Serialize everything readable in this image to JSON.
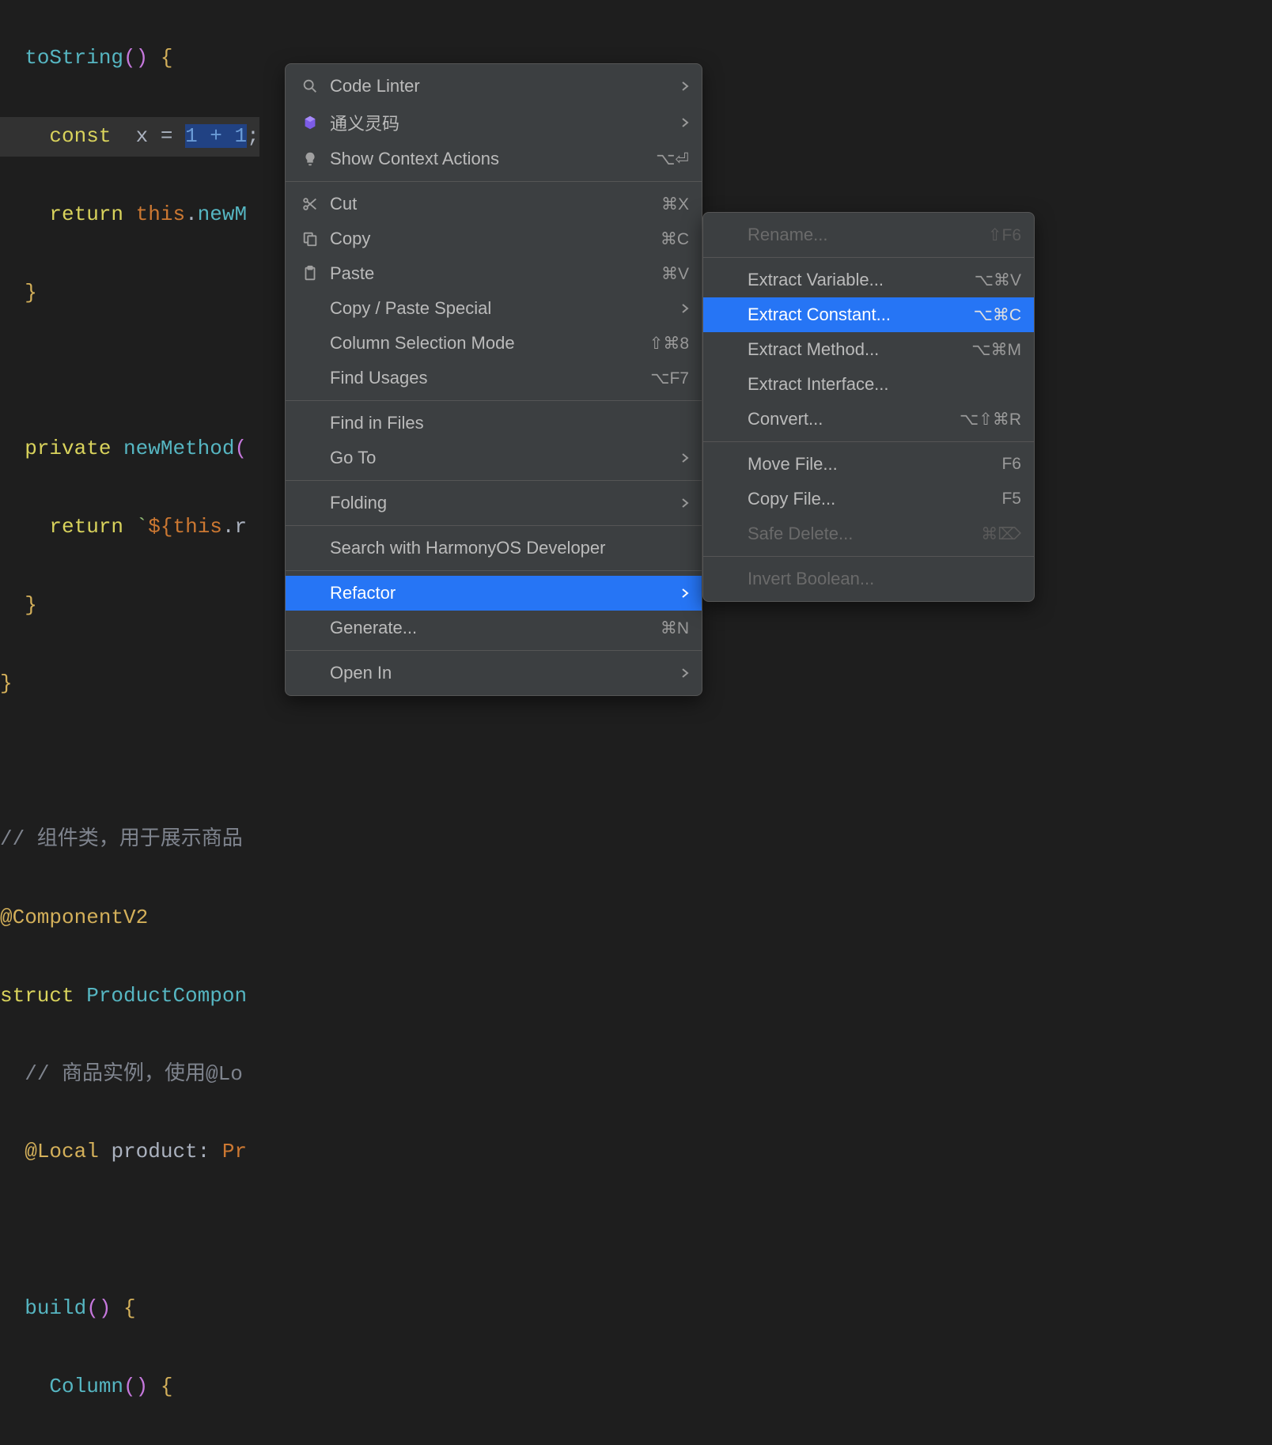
{
  "code": {
    "line1_method": "toString",
    "line1_parens": "()",
    "line1_brace": " {",
    "line2_const": "const",
    "line2_var": "  x ",
    "line2_eq": "= ",
    "line2_sel": "1 + 1",
    "line2_semi": ";",
    "line3_return": "return",
    "line3_this": " this",
    "line3_dot": ".",
    "line3_method": "newM",
    "line4_brace": "}",
    "line6_private": "private",
    "line6_method": " newMethod",
    "line6_paren": "(",
    "line7_return": "return",
    "line7_tmpl_open": " `",
    "line7_dollar": "${",
    "line7_this": "this",
    "line7_dot": ".",
    "line7_rest": "r",
    "line8_brace": "}",
    "line9_brace": "}",
    "line11_comment": "// 组件类，用于展示商品",
    "line12_ann": "@ComponentV2",
    "line13_struct": "struct",
    "line13_name": " ProductCompon",
    "line14_comment": "// 商品实例，使用@Lo",
    "line15_ann": "@Local",
    "line15_prod": " product",
    "line15_colon": ": ",
    "line15_type": "Pr",
    "line17_build": "build",
    "line17_parens": "()",
    "line17_brace": " {",
    "line18_col": "Column",
    "line18_parens": "()",
    "line18_brace": " {"
  },
  "main_menu": [
    {
      "icon": "magnify-icon",
      "label": "Code Linter",
      "arrow": true
    },
    {
      "icon": "tongyi-icon",
      "label": "通义灵码",
      "arrow": true
    },
    {
      "icon": "bulb-icon",
      "label": "Show Context Actions",
      "shortcut": "⌥⏎"
    },
    {
      "separator": true
    },
    {
      "icon": "scissors-icon",
      "label": "Cut",
      "shortcut": "⌘X"
    },
    {
      "icon": "copy-icon",
      "label": "Copy",
      "shortcut": "⌘C"
    },
    {
      "icon": "clipboard-icon",
      "label": "Paste",
      "shortcut": "⌘V"
    },
    {
      "label": "Copy / Paste Special",
      "arrow": true,
      "noicon": true
    },
    {
      "label": "Column Selection Mode",
      "shortcut": "⇧⌘8",
      "noicon": true
    },
    {
      "label": "Find Usages",
      "shortcut": "⌥F7",
      "noicon": true
    },
    {
      "separator": true
    },
    {
      "label": "Find in Files",
      "noicon": true
    },
    {
      "label": "Go To",
      "arrow": true,
      "noicon": true
    },
    {
      "separator": true
    },
    {
      "label": "Folding",
      "arrow": true,
      "noicon": true
    },
    {
      "separator": true
    },
    {
      "label": "Search with HarmonyOS Developer",
      "noicon": true
    },
    {
      "separator": true
    },
    {
      "label": "Refactor",
      "arrow": true,
      "noicon": true,
      "selected": true
    },
    {
      "label": "Generate...",
      "shortcut": "⌘N",
      "noicon": true
    },
    {
      "separator": true
    },
    {
      "label": "Open In",
      "arrow": true,
      "noicon": true
    }
  ],
  "sub_menu": [
    {
      "label": "Rename...",
      "shortcut": "⇧F6",
      "disabled": true
    },
    {
      "separator": true
    },
    {
      "label": "Extract Variable...",
      "shortcut": "⌥⌘V"
    },
    {
      "label": "Extract Constant...",
      "shortcut": "⌥⌘C",
      "selected": true
    },
    {
      "label": "Extract Method...",
      "shortcut": "⌥⌘M"
    },
    {
      "label": "Extract Interface..."
    },
    {
      "label": "Convert...",
      "shortcut": "⌥⇧⌘R"
    },
    {
      "separator": true
    },
    {
      "label": "Move File...",
      "shortcut": "F6"
    },
    {
      "label": "Copy File...",
      "shortcut": "F5"
    },
    {
      "label": "Safe Delete...",
      "shortcut": "⌘⌦",
      "disabled": true
    },
    {
      "separator": true
    },
    {
      "label": "Invert Boolean...",
      "disabled": true
    }
  ]
}
